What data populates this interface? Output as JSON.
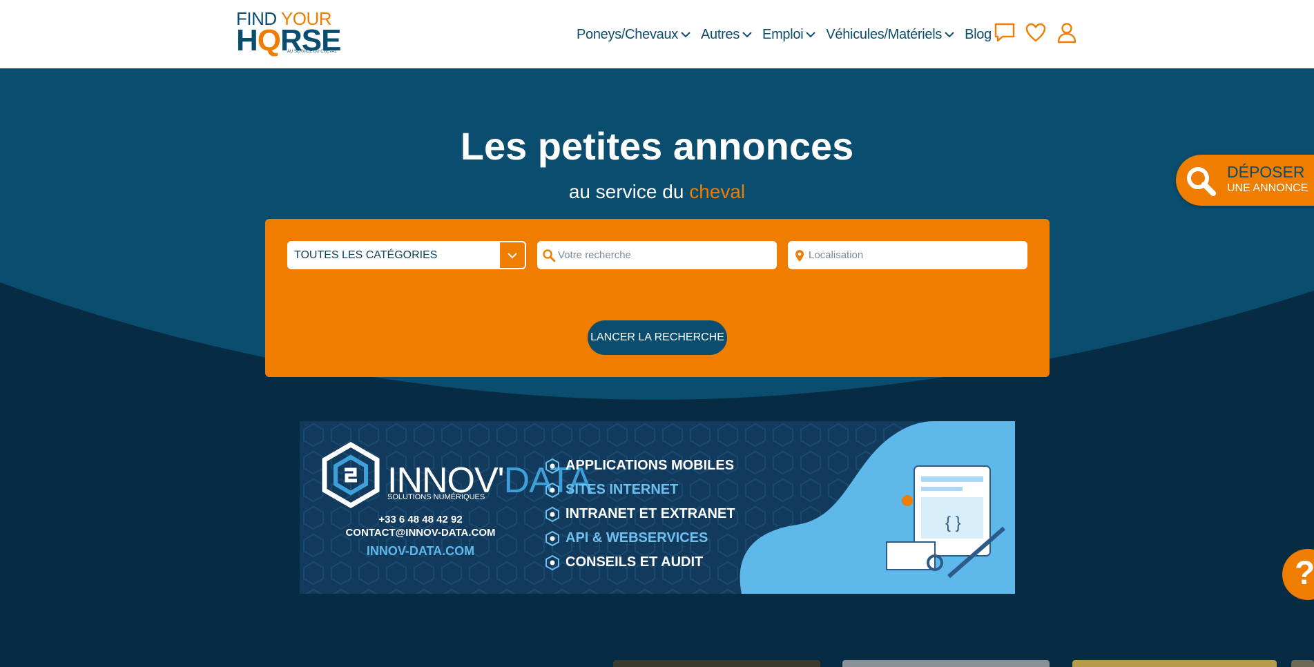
{
  "logo": {
    "line1_a": "FIND ",
    "line1_b": "YOUR",
    "line2_a": "H",
    "line2_o": "Q",
    "line2_b": "RSE",
    "tagline": "AU SERVICE DU CHEVAL"
  },
  "nav": {
    "items": [
      {
        "label": "Poneys/Chevaux",
        "has_dropdown": true
      },
      {
        "label": "Autres",
        "has_dropdown": true
      },
      {
        "label": "Emploi",
        "has_dropdown": true
      },
      {
        "label": "Véhicules/Matériels",
        "has_dropdown": true
      },
      {
        "label": "Blog",
        "has_dropdown": false
      }
    ],
    "icons": [
      "chat-icon",
      "heart-icon",
      "user-icon"
    ]
  },
  "hero": {
    "title": "Les petites annonces",
    "subtitle_a": "au service du ",
    "subtitle_b": "cheval"
  },
  "search": {
    "category_value": "TOUTES LES CATÉGORIES",
    "query_placeholder": "Votre recherche",
    "location_placeholder": "Localisation",
    "submit_label": "LANCER LA RECHERCHE"
  },
  "deposer": {
    "line1": "DÉPOSER",
    "line2": "UNE ANNONCE"
  },
  "banner": {
    "brand_a": "INNOV'",
    "brand_b": "DATA",
    "brand_sub": "SOLUTIONS NUMÉRIQUES",
    "phone": "+33 6 48 48 42 92",
    "email": "CONTACT@INNOV-DATA.COM",
    "site": "INNOV-DATA.COM",
    "services": [
      {
        "label": "APPLICATIONS MOBILES",
        "color": "white"
      },
      {
        "label": "SITES INTERNET",
        "color": "blue"
      },
      {
        "label": "INTRANET ET EXTRANET",
        "color": "white"
      },
      {
        "label": "API & WEBSERVICES",
        "color": "blue"
      },
      {
        "label": "CONSEILS ET AUDIT",
        "color": "white"
      }
    ]
  },
  "help": {
    "label": "?"
  },
  "colors": {
    "orange": "#ee7d00",
    "navy": "#0b4d6e",
    "hero_top": "#0b4d6e",
    "hero_bottom": "#062b42"
  }
}
